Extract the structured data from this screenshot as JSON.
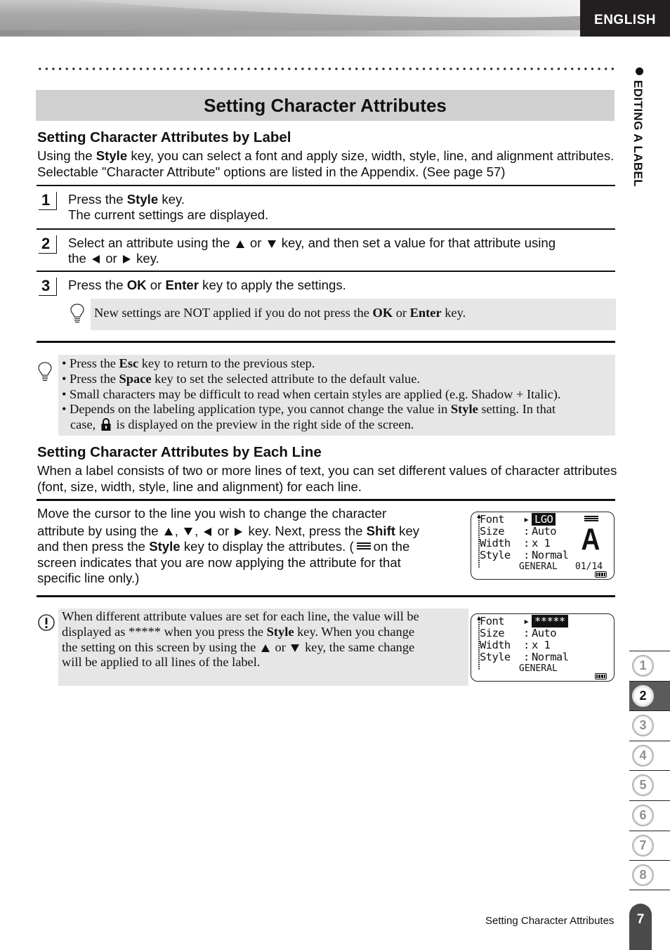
{
  "header": {
    "language": "ENGLISH",
    "side_label": "EDITING A LABEL"
  },
  "title": "Setting Character Attributes",
  "section1": {
    "heading": "Setting Character Attributes by Label",
    "intro_pre": "Using the ",
    "intro_bold": "Style",
    "intro_post": " key, you can select a font and apply size, width, style, line, and alignment attributes. Selectable \"Character Attribute\" options are listed in the Appendix. (See page 57)",
    "steps": [
      {
        "number": "1",
        "line1_pre": "Press the ",
        "line1_bold": "Style",
        "line1_post": " key.",
        "line2": "The current settings are displayed."
      },
      {
        "number": "2",
        "part1": "Select an attribute using the",
        "part2": "or",
        "part3": "key, and then set a value for that attribute using",
        "part4": "the",
        "part5": "or",
        "part6": "key."
      },
      {
        "number": "3",
        "pre": "Press the ",
        "bold1": "OK",
        "mid": " or ",
        "bold2": "Enter",
        "post": " key to apply the settings."
      }
    ],
    "step3_note": {
      "pre": "New settings are NOT applied if you do not press the ",
      "bold1": "OK",
      "mid": " or ",
      "bold2": "Enter",
      "post": " key."
    },
    "tips": [
      {
        "pre": "Press the ",
        "bold": "Esc",
        "post": " key to return to the previous step."
      },
      {
        "pre": "Press the ",
        "bold": "Space",
        "post": " key to set the selected attribute to the default value."
      },
      {
        "pre": "Small characters may be difficult to read when certain styles are applied (e.g. Shadow + Italic).",
        "bold": "",
        "post": ""
      },
      {
        "pre": "Depends on the labeling application type, you cannot change the value in ",
        "bold": "Style",
        "post": " setting. In that",
        "line2_pre": "case,",
        "line2_post": "is displayed on the preview in the right side of the screen."
      }
    ]
  },
  "section2": {
    "heading": "Setting Character Attributes by Each Line",
    "intro": "When a label consists of two or more lines of text, you can set different values of character attributes (font, size, width, style, line and alignment) for each line.",
    "body": {
      "l1": "Move the cursor to the line you wish to change the character",
      "l2_pre": "attribute by using the",
      "l2_sep1": ",",
      "l2_sep2": ",",
      "l2_or": "or",
      "l2_post": "key. Next, press the",
      "l2_bold": "Shift",
      "l2_end": "key",
      "l3_pre": "and then press the ",
      "l3_bold": "Style",
      "l3_post": " key to display the attributes. (",
      "l3_end": "on the",
      "l4": "screen indicates that you are now applying the attribute for that",
      "l5": "specific line only.)"
    },
    "lcd1": {
      "rows": [
        {
          "label": "Font",
          "sep": ":",
          "value": "LGO",
          "selected": true
        },
        {
          "label": "Size",
          "sep": ":",
          "value": "Auto"
        },
        {
          "label": "Width",
          "sep": ":",
          "value": "x 1"
        },
        {
          "label": "Style",
          "sep": ":",
          "value": "Normal"
        }
      ],
      "preview_char": "A",
      "footer": "GENERAL",
      "page": "01/14"
    },
    "warning": {
      "l1": "When different attribute values are set for each line, the value will be",
      "l2_pre": "displayed as ***** when you press the ",
      "l2_bold": "Style",
      "l2_post": " key. When you change",
      "l3_pre": "the setting on this screen by using the",
      "l3_or": "or",
      "l3_post": "key, the same change",
      "l4": "will be applied to all lines of the label."
    },
    "lcd2": {
      "rows": [
        {
          "label": "Font",
          "sep": ":",
          "value": "*****",
          "selected": true
        },
        {
          "label": "Size",
          "sep": ":",
          "value": "Auto"
        },
        {
          "label": "Width",
          "sep": ":",
          "value": "x 1"
        },
        {
          "label": "Style",
          "sep": ":",
          "value": "Normal"
        }
      ],
      "footer": "GENERAL"
    }
  },
  "chapters": {
    "items": [
      "1",
      "2",
      "3",
      "4",
      "5",
      "6",
      "7",
      "8"
    ],
    "active": "2"
  },
  "footer": {
    "section_title": "Setting Character Attributes",
    "page_number": "7"
  }
}
